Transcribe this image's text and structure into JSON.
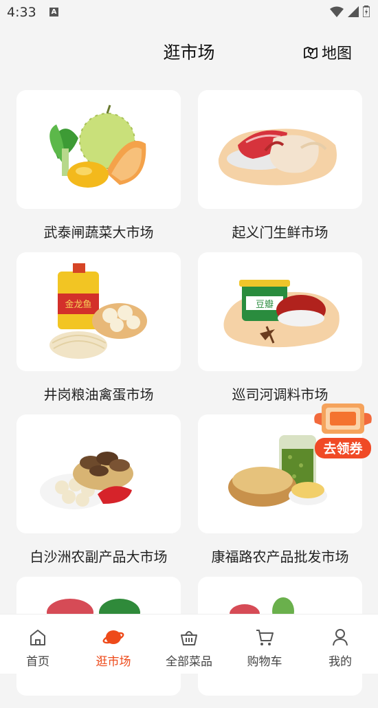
{
  "status": {
    "time": "4:33"
  },
  "header": {
    "title": "逛市场",
    "map_label": "地图"
  },
  "markets": [
    {
      "name": "武泰闸蔬菜大市场"
    },
    {
      "name": "起义门生鲜市场"
    },
    {
      "name": "井岗粮油禽蛋市场"
    },
    {
      "name": "巡司河调料市场"
    },
    {
      "name": "白沙洲农副产品大市场"
    },
    {
      "name": "康福路农产品批发市场"
    },
    {
      "name": ""
    },
    {
      "name": ""
    }
  ],
  "product_text": {
    "oil_brand": "金龙鱼",
    "bean_paste": "豆瓣"
  },
  "coupon": {
    "label": "去领券"
  },
  "tabs": [
    {
      "label": "首页"
    },
    {
      "label": "逛市场"
    },
    {
      "label": "全部菜品"
    },
    {
      "label": "购物车"
    },
    {
      "label": "我的"
    }
  ],
  "colors": {
    "accent": "#ee4a1a",
    "background": "#f4f4f4"
  }
}
